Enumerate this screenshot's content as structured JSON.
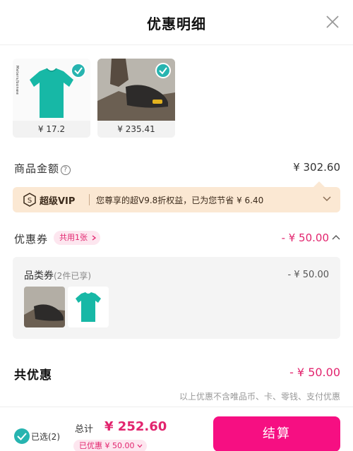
{
  "header": {
    "title": "优惠明细"
  },
  "products": [
    {
      "price": "¥ 17.2",
      "brand": "Meters/bonwe"
    },
    {
      "price": "¥ 235.41"
    }
  ],
  "amount": {
    "label": "商品金额",
    "value": "¥ 302.60"
  },
  "vip": {
    "name": "超级VIP",
    "desc": "您尊享的超V9.8折权益，已为您节省 ¥ 6.40"
  },
  "coupon": {
    "label": "优惠券",
    "pill": "共用1张",
    "value": "- ¥ 50.00"
  },
  "coupon_detail": {
    "label": "品类券",
    "sub": "(2件已享)",
    "value": "- ¥ 50.00"
  },
  "total": {
    "label": "共优惠",
    "value": "- ¥ 50.00"
  },
  "note": "以上优惠不含唯品币、卡、零钱、支付优惠",
  "footer": {
    "selected": "已选(2)",
    "sum_label": "总计",
    "sum_value": "¥ 252.60",
    "discount": "已优惠 ¥ 50.00",
    "pay_button": "结算"
  },
  "colors": {
    "accent": "#f60f82",
    "price_pink": "#e2246e",
    "check_teal": "#27b4b0",
    "vip_bg": "#fbe8d3"
  }
}
